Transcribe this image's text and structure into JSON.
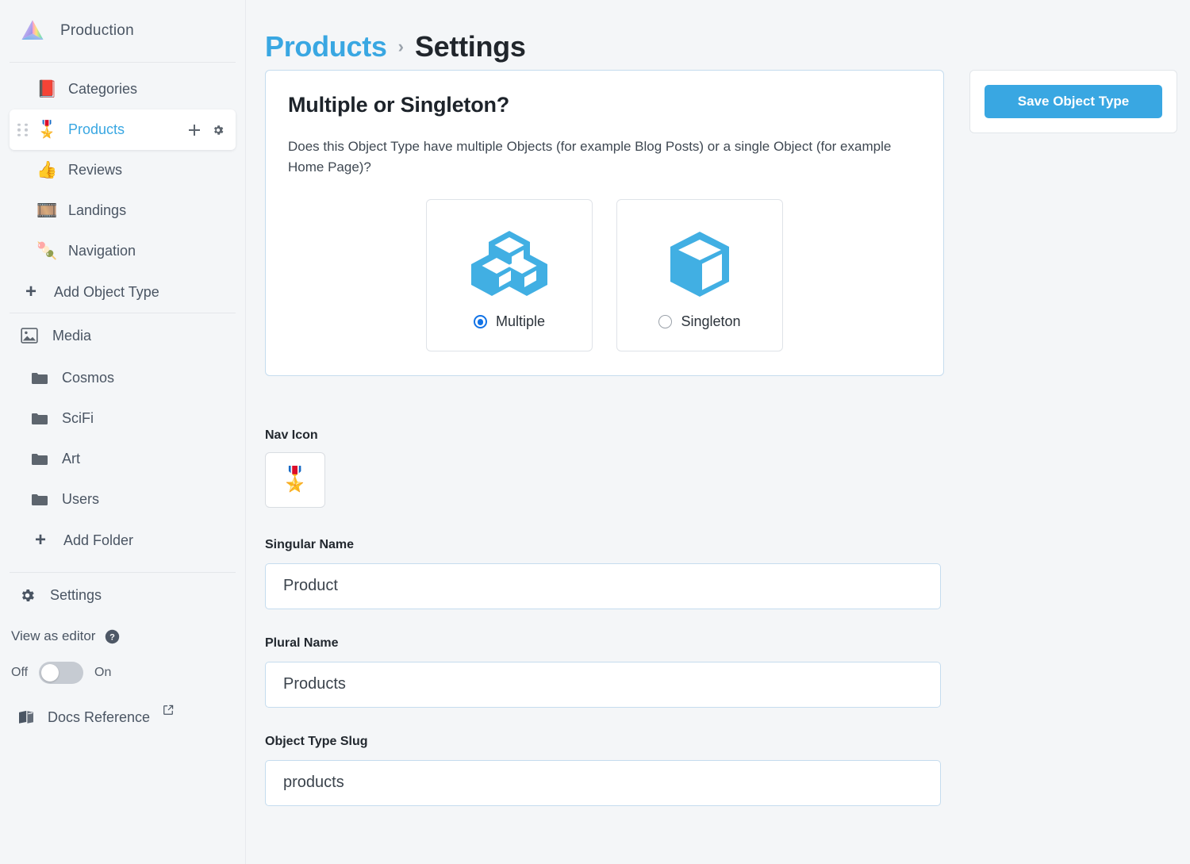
{
  "sidebar": {
    "brand": {
      "name": "Production",
      "logo_icon": "prism-logo-icon"
    },
    "object_types": [
      {
        "label": "Categories",
        "emoji": "📕",
        "icon_name": "closed-book-emoji",
        "active": false
      },
      {
        "label": "Products",
        "emoji": "🎖️",
        "icon_name": "military-medal-emoji",
        "active": true
      },
      {
        "label": "Reviews",
        "emoji": "👍",
        "icon_name": "thumbs-up-emoji",
        "active": false
      },
      {
        "label": "Landings",
        "emoji": "🎞️",
        "icon_name": "film-frames-emoji",
        "active": false
      },
      {
        "label": "Navigation",
        "emoji": "🍡",
        "icon_name": "dango-emoji",
        "active": false
      }
    ],
    "add_object_type": {
      "label": "Add Object Type",
      "plus": "+"
    },
    "media": {
      "label": "Media",
      "icon_name": "image-icon"
    },
    "folders": [
      {
        "label": "Cosmos"
      },
      {
        "label": "SciFi"
      },
      {
        "label": "Art"
      },
      {
        "label": "Users"
      }
    ],
    "add_folder": {
      "label": "Add Folder",
      "plus": "+"
    },
    "settings": {
      "label": "Settings",
      "icon_name": "gear-icon"
    },
    "view_as_editor": {
      "label": "View as editor",
      "help_icon": "question-mark-circle-icon",
      "off_label": "Off",
      "on_label": "On",
      "state": "Off"
    },
    "docs_reference": {
      "label": "Docs Reference",
      "icon_name": "book-icon",
      "external_icon": "external-link-icon"
    }
  },
  "breadcrumb": {
    "parent": "Products",
    "separator": "›",
    "current": "Settings"
  },
  "card": {
    "title": "Multiple or Singleton?",
    "description": "Does this Object Type have multiple Objects (for example Blog Posts) or a single Object (for example Home Page)?",
    "options": [
      {
        "label": "Multiple",
        "icon_name": "three-cubes-icon",
        "selected": true
      },
      {
        "label": "Singleton",
        "icon_name": "single-cube-icon",
        "selected": false
      }
    ]
  },
  "form": {
    "nav_icon": {
      "label": "Nav Icon",
      "value": "🎖️",
      "icon_name": "military-medal-emoji"
    },
    "singular_name": {
      "label": "Singular Name",
      "value": "Product",
      "placeholder": "Singular Name"
    },
    "plural_name": {
      "label": "Plural Name",
      "value": "Products",
      "placeholder": "Plural Name"
    },
    "object_type_slug": {
      "label": "Object Type Slug",
      "value": "products",
      "placeholder": "Object Type Slug"
    }
  },
  "actions": {
    "save_label": "Save Object Type"
  },
  "colors": {
    "accent_blue": "#39a7e2",
    "radio_blue": "#1273e6",
    "page_bg": "#f4f6f8",
    "card_border": "#c5dcee",
    "text_dark": "#21262c"
  }
}
